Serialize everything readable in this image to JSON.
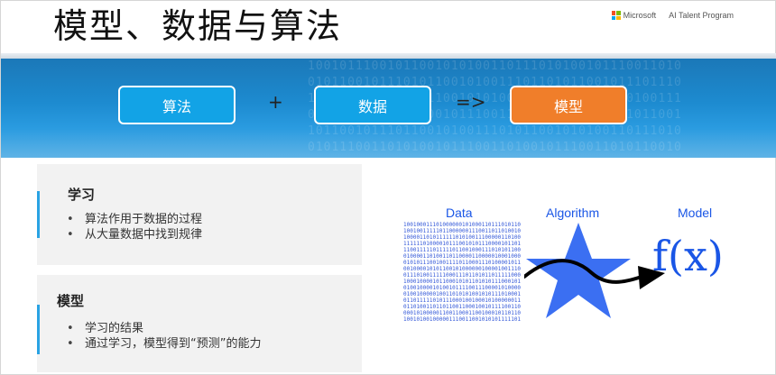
{
  "title": "模型、数据与算法",
  "brand": {
    "company": "Microsoft",
    "program": "AI Talent Program"
  },
  "banner": {
    "algorithm": "算法",
    "plus": "+",
    "data": "数据",
    "arrow": "=>",
    "model": "模型"
  },
  "sections": [
    {
      "heading": "学习",
      "bullets": [
        "算法作用于数据的过程",
        "从大量数据中找到规律"
      ]
    },
    {
      "heading": "模型",
      "bullets": [
        "学习的结果",
        "通过学习，模型得到“预测”的能力"
      ]
    }
  ],
  "diagram": {
    "data_label": "Data",
    "algorithm_label": "Algorithm",
    "model_label": "Model",
    "formula": "f(x)"
  },
  "colors": {
    "accent_blue": "#12a3e6",
    "accent_orange": "#f07e2a",
    "diagram_blue": "#1a56e6",
    "star_blue": "#3b6ff2"
  }
}
